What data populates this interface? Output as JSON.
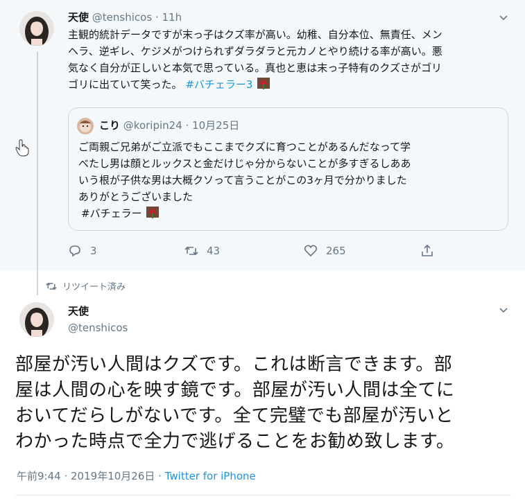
{
  "tweet1": {
    "name": "天使",
    "handle": "@tenshicos",
    "time": "11h",
    "text": "主観的統計データですが末っ子はクズ率が高い。幼稚、自分本位、無責任、メンヘラ、逆ギレ、ケジメがつけられずダラダラと元カノとやり続ける率が高い。悪気なく自分が正しいと本気で思っている。真也と恵は末っ子特有のクズさがゴリゴリに出ていて笑った。",
    "hashtag": "#バチェラー3",
    "quote": {
      "name": "こり",
      "handle": "@koripin24",
      "date": "10月25日",
      "lines": [
        "ご両親ご兄弟がご立派でもここまでクズに育つことがあるんだなって学",
        "べたし男は顔とルックスと金だけじゃ分からないことが多すぎるしああ",
        "いう根が子供な男は大概クソって言うことがこの3ヶ月で分かりました",
        "ありがとうございました"
      ],
      "hashtag": "#バチェラー"
    },
    "actions": {
      "replies": "3",
      "retweets": "43",
      "likes": "265"
    },
    "icons": {
      "reply": "reply-icon",
      "retweet": "retweet-icon",
      "like": "heart-icon",
      "share": "share-icon",
      "menu": "chevron-down-icon"
    }
  },
  "retweet_context": "リツイート済み",
  "tweet2": {
    "name": "天使",
    "handle": "@tenshicos",
    "lines": [
      "部屋が汚い人間はクズです。これは断言できます。部",
      "屋は人間の心を映す鏡です。部屋が汚い人間は全てに",
      "おいてだらしがないです。全て完璧でも部屋が汚いと",
      "わかった時点で全力で逃げることをお勧め致します。"
    ],
    "time": "午前9:44",
    "date": "2019年10月26日",
    "source": "Twitter for iPhone"
  },
  "colors": {
    "link": "#1b95e0",
    "muted": "#657786",
    "highlight_bg": "#f5f8fa",
    "border": "#ccd6dd"
  }
}
